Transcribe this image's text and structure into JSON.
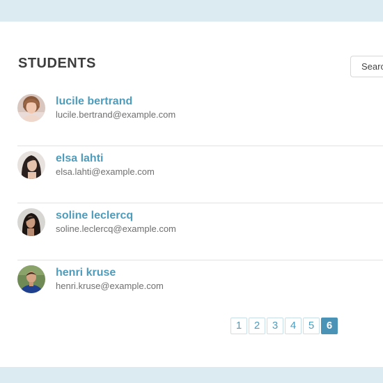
{
  "page": {
    "title": "STUDENTS",
    "search_placeholder": "Search"
  },
  "students": [
    {
      "name": "lucile bertrand",
      "email": "lucile.bertrand@example.com"
    },
    {
      "name": "elsa lahti",
      "email": "elsa.lahti@example.com"
    },
    {
      "name": "soline leclercq",
      "email": "soline.leclercq@example.com"
    },
    {
      "name": "henri kruse",
      "email": "henri.kruse@example.com"
    }
  ],
  "pagination": {
    "pages": [
      "1",
      "2",
      "3",
      "4",
      "5",
      "6"
    ],
    "current": "6"
  },
  "colors": {
    "accent": "#4e9cbc",
    "page_background": "#dcebf1",
    "active_page": "#4a93b6"
  }
}
